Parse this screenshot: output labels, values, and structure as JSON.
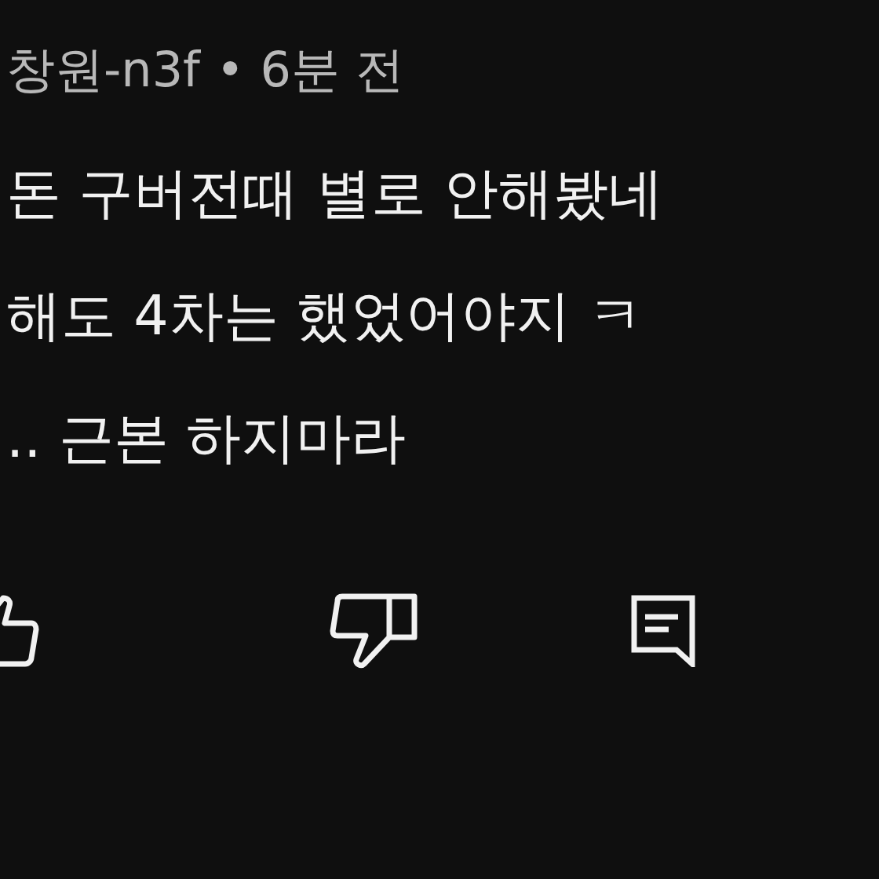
{
  "comment": {
    "author": "창원-n3f",
    "separator": "•",
    "time": "6분 전",
    "lines": [
      "돈 구버전때 별로 안해봤네",
      "해도 4차는 했었어야지 ㅋ",
      ".. 근본 하지마라"
    ]
  },
  "actions": [
    {
      "kind": "like"
    },
    {
      "kind": "dislike"
    },
    {
      "kind": "reply"
    }
  ]
}
